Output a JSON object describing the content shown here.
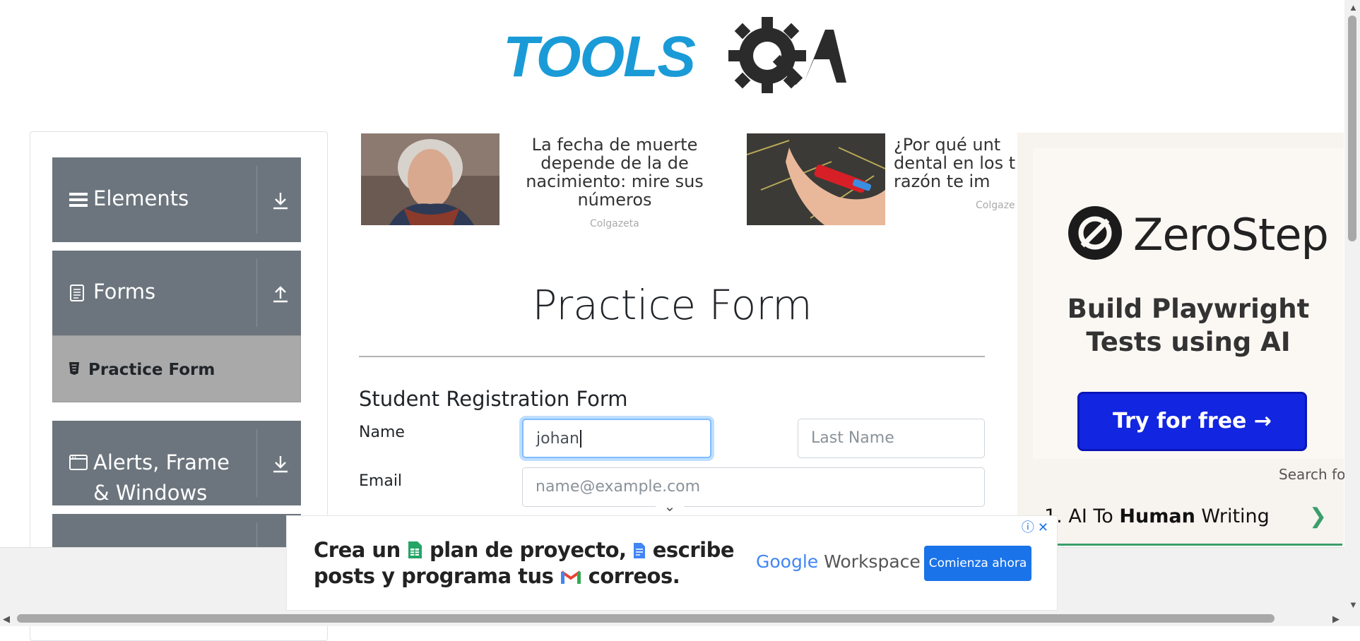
{
  "header": {
    "logo_text": "TOOLS",
    "logo_suffix": "A"
  },
  "sidebar": {
    "groups": [
      {
        "label": "Elements",
        "icon": "hamburger-icon",
        "expanded": false
      },
      {
        "label": "Forms",
        "icon": "document-icon",
        "expanded": true
      },
      {
        "label": "Alerts, Frame & Windows",
        "icon": "window-icon",
        "expanded": false
      }
    ],
    "active_item": "Practice Form"
  },
  "sponsored": [
    {
      "text": "La fecha de muerte depende de la de nacimiento: mire sus números",
      "source": "Colgazeta"
    },
    {
      "text": "¿Por qué unt dental en los t razón te im",
      "source": "Colgaze"
    }
  ],
  "form": {
    "title": "Practice Form",
    "heading": "Student Registration Form",
    "name_label": "Name",
    "first_name_value": "johan",
    "last_name_placeholder": "Last Name",
    "email_label": "Email",
    "email_placeholder": "name@example.com"
  },
  "right_ad": {
    "brand": "ZeroStep",
    "tagline": "Build Playwright Tests using AI",
    "cta": "Try for free →",
    "search_for": "Search fo",
    "result_num": "1.",
    "result_pre": "AI To ",
    "result_bold": "Human",
    "result_post": " Writing",
    "accent": "#1225e0"
  },
  "bottom_ad": {
    "line1": "Crea un",
    "line1b": "plan de proyecto,",
    "line1c": "escribe",
    "line2": "posts y programa tus",
    "line2b": "correos.",
    "brand_google": "Google",
    "brand_workspace": "Workspace",
    "cta": "Comienza ahora"
  }
}
